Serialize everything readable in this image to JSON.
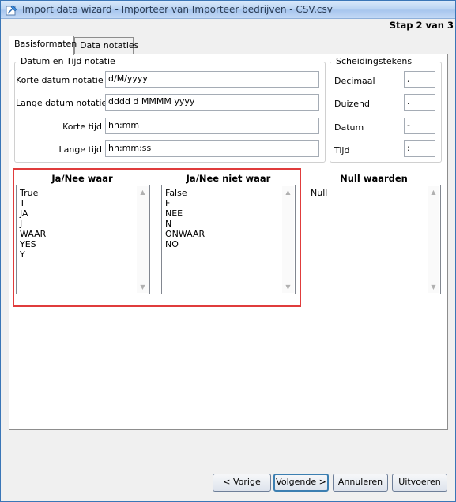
{
  "window": {
    "title": "Import data wizard - Importeer van Importeer bedrijven - CSV.csv",
    "step": "Stap 2 van 3"
  },
  "tabs": [
    {
      "label": "Basisformaten",
      "active": true
    },
    {
      "label": "Data notaties",
      "active": false
    }
  ],
  "datetime": {
    "legend": "Datum en Tijd notatie",
    "fields": [
      {
        "label": "Korte datum notatie",
        "value": "d/M/yyyy"
      },
      {
        "label": "Lange datum notatie",
        "value": "dddd d MMMM yyyy"
      },
      {
        "label": "Korte tijd",
        "value": "hh:mm"
      },
      {
        "label": "Lange tijd",
        "value": "hh:mm:ss"
      }
    ]
  },
  "separators": {
    "legend": "Scheidingstekens",
    "fields": [
      {
        "label": "Decimaal",
        "value": ","
      },
      {
        "label": "Duizend",
        "value": "."
      },
      {
        "label": "Datum",
        "value": "-"
      },
      {
        "label": "Tijd",
        "value": ":"
      }
    ]
  },
  "lists": {
    "true_values": {
      "title": "Ja/Nee waar",
      "items": [
        "True",
        "T",
        "JA",
        "J",
        "WAAR",
        "YES",
        "Y"
      ]
    },
    "false_values": {
      "title": "Ja/Nee niet waar",
      "items": [
        "False",
        "F",
        "NEE",
        "N",
        "ONWAAR",
        "NO"
      ]
    },
    "null_values": {
      "title": "Null waarden",
      "items": [
        "Null"
      ]
    }
  },
  "buttons": {
    "prev": "< Vorige",
    "next": "Volgende >",
    "cancel": "Annuleren",
    "run": "Uitvoeren"
  },
  "colors": {
    "highlight": "#e03c3c",
    "title_bar": "#bcd5f3"
  }
}
